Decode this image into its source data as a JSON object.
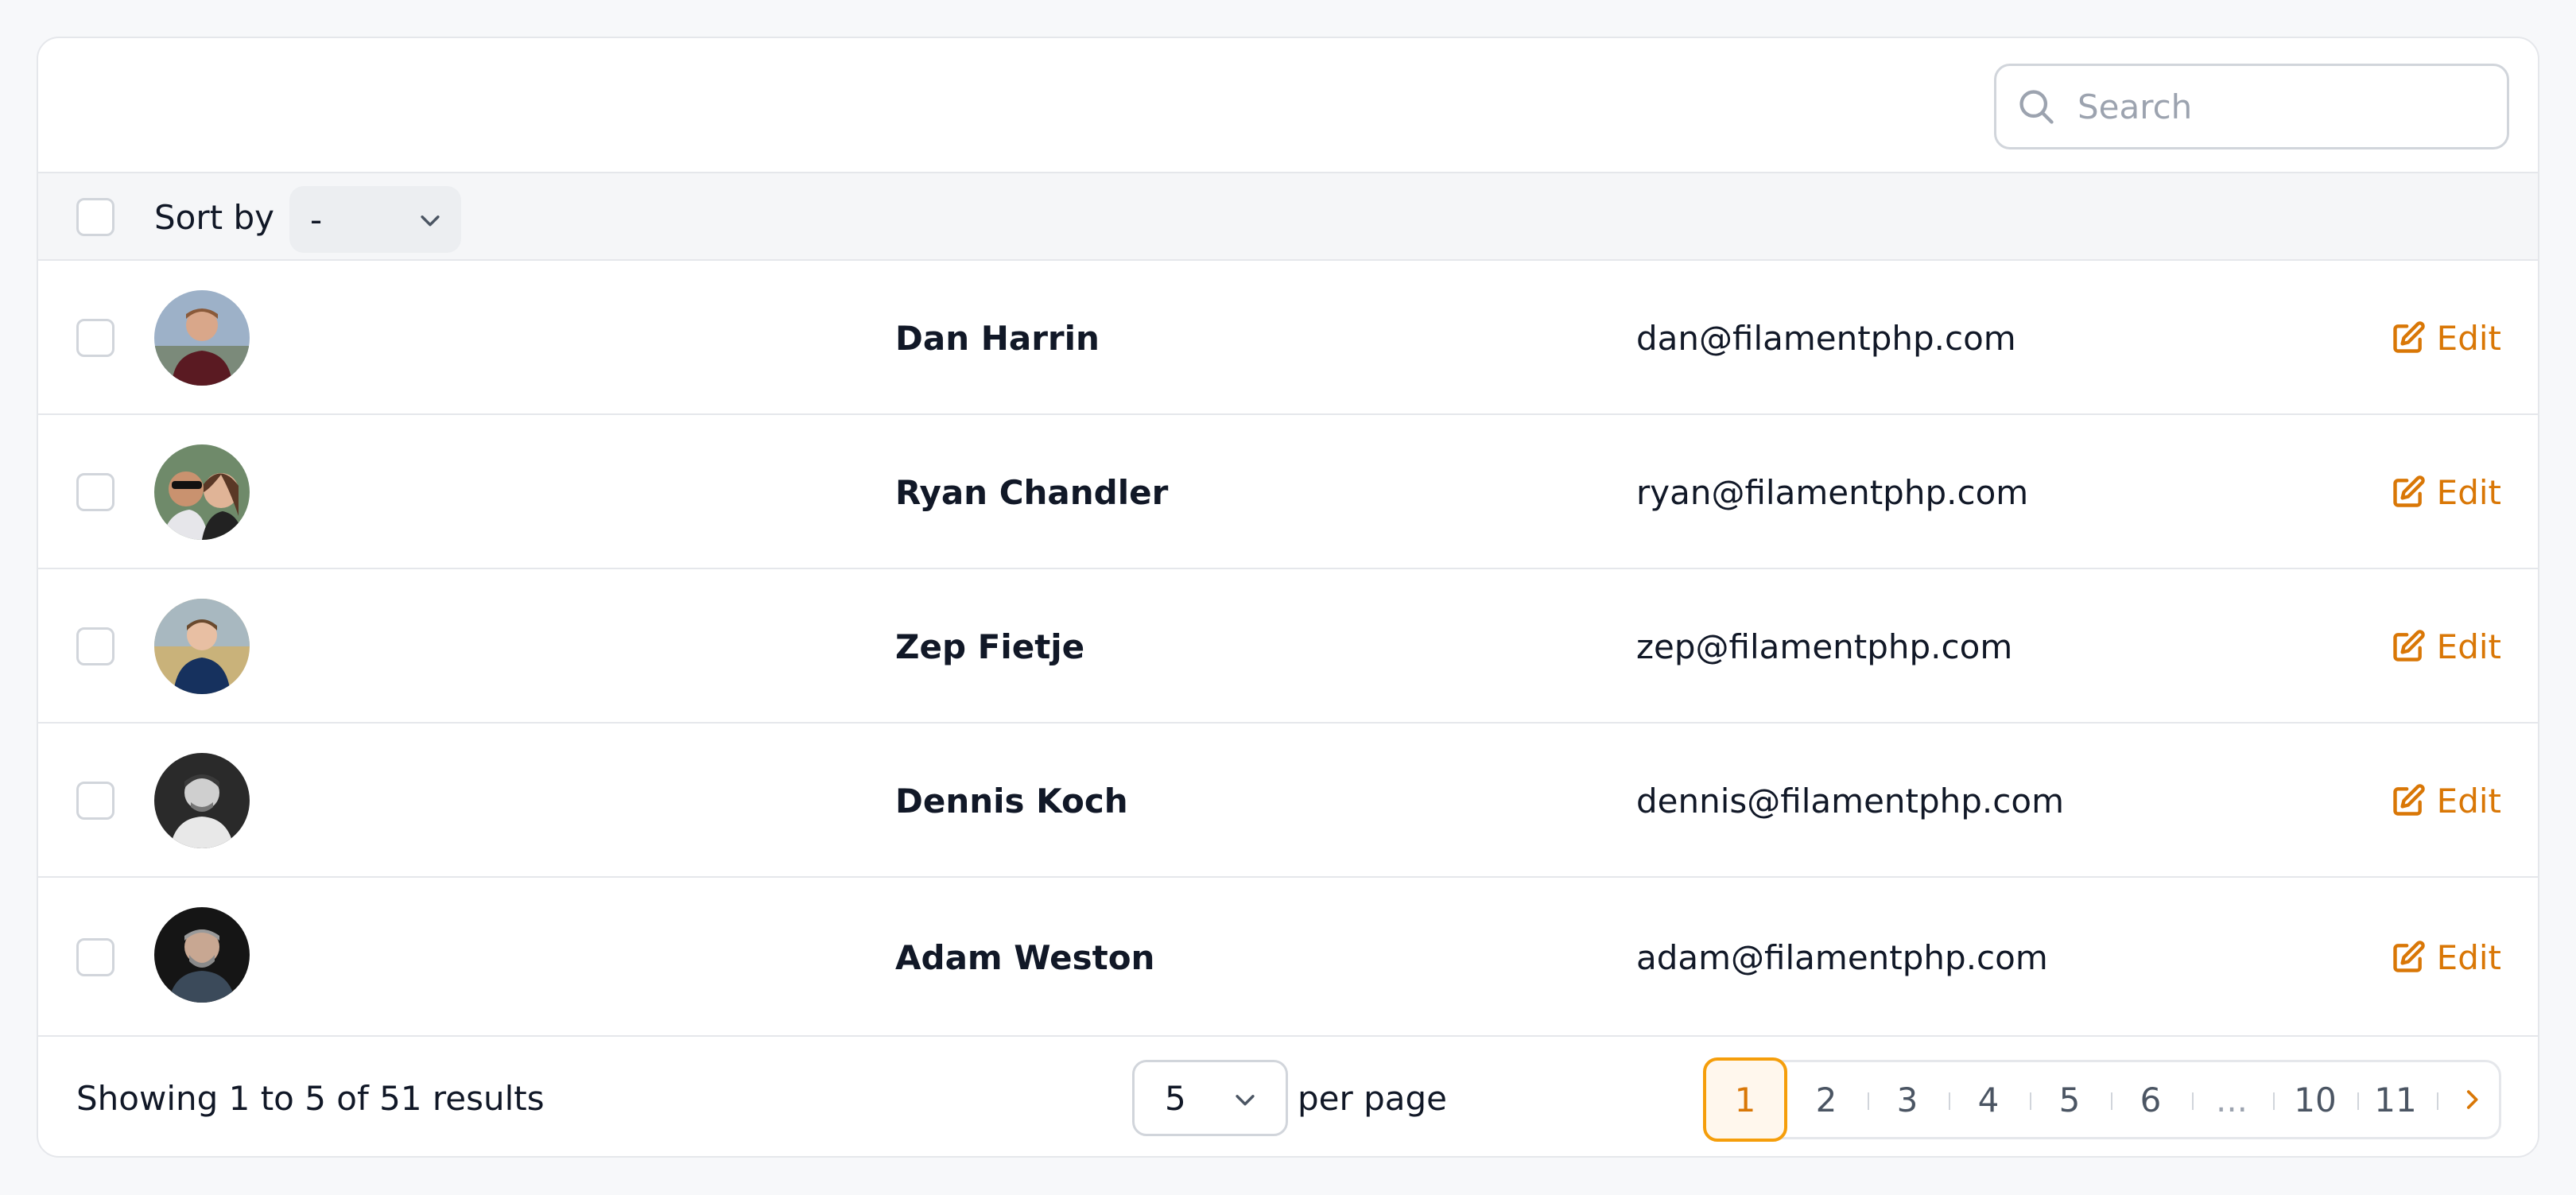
{
  "search": {
    "placeholder": "Search"
  },
  "sort": {
    "label": "Sort by",
    "selected": "-"
  },
  "rows": [
    {
      "name": "Dan Harrin",
      "email": "dan@filamentphp.com",
      "edit_label": "Edit"
    },
    {
      "name": "Ryan Chandler",
      "email": "ryan@filamentphp.com",
      "edit_label": "Edit"
    },
    {
      "name": "Zep Fietje",
      "email": "zep@filamentphp.com",
      "edit_label": "Edit"
    },
    {
      "name": "Dennis Koch",
      "email": "dennis@filamentphp.com",
      "edit_label": "Edit"
    },
    {
      "name": "Adam Weston",
      "email": "adam@filamentphp.com",
      "edit_label": "Edit"
    }
  ],
  "footer": {
    "showing": "Showing 1 to 5 of 51 results",
    "per_page_value": "5",
    "per_page_label": "per page",
    "pages": [
      "1",
      "2",
      "3",
      "4",
      "5",
      "6",
      "...",
      "10",
      "11"
    ],
    "current_page": "1"
  },
  "colors": {
    "accent": "#d97706",
    "accent_border": "#f59e0b",
    "accent_bg": "#fff7ed"
  },
  "icons": {
    "search": "search-icon",
    "sort_chevron": "chevron-down-icon",
    "edit": "pencil-square-icon",
    "next": "chevron-right-icon"
  }
}
